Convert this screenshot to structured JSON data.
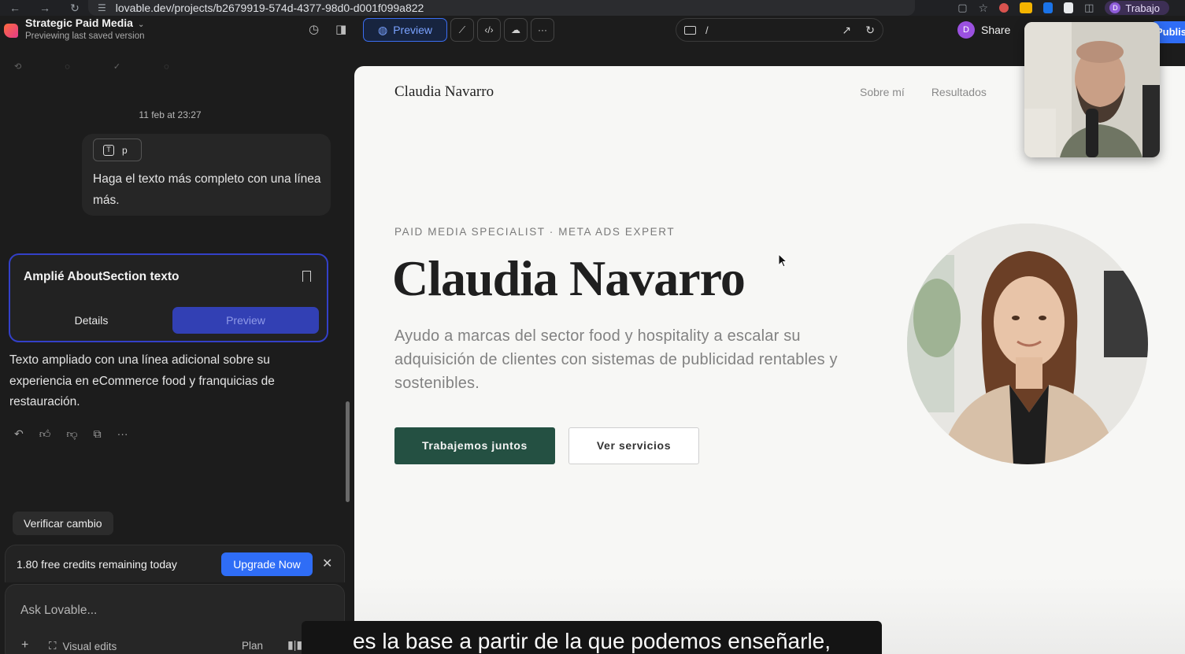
{
  "browser": {
    "url": "lovable.dev/projects/b2679919-574d-4377-98d0-d001f099a822",
    "profile_name": "Trabajo",
    "profile_initial": "D"
  },
  "app": {
    "project_name": "Strategic Paid Media",
    "project_status": "Previewing last saved version",
    "preview_label": "Preview",
    "route": "/",
    "share_label": "Share",
    "share_initial": "D",
    "publish_label": "Publish"
  },
  "chat": {
    "date": "11 feb at 23:27",
    "user_chip": "p",
    "user_message": "Haga el texto más completo con una línea más.",
    "card_title": "Amplié AboutSection texto",
    "card_tabs": {
      "details": "Details",
      "preview": "Preview"
    },
    "assistant_reply": "Texto ampliado con una línea adicional sobre su experiencia en eCommerce food y franquicias de restauración.",
    "verify_label": "Verificar cambio",
    "credits_text": "1.80 free credits remaining today",
    "upgrade_label": "Upgrade Now",
    "composer_placeholder": "Ask Lovable...",
    "visual_edits_label": "Visual edits",
    "plan_label": "Plan"
  },
  "site": {
    "brand": "Claudia Navarro",
    "nav": [
      "Sobre mí",
      "Resultados"
    ],
    "eyebrow": "PAID MEDIA SPECIALIST · META ADS EXPERT",
    "title": "Claudia Navarro",
    "description": "Ayudo a marcas del sector food y hospitality a escalar su adquisición de clientes con sistemas de publicidad rentables y sostenibles.",
    "cta_primary": "Trabajemos juntos",
    "cta_secondary": "Ver servicios"
  },
  "subtitle": "es la base a partir de la que podemos enseñarle,",
  "colors": {
    "accent_blue": "#2f6df6",
    "card_border": "#3340c8",
    "site_primary": "#245042",
    "app_bg": "#1c1c1c",
    "site_bg": "#f7f7f5"
  }
}
